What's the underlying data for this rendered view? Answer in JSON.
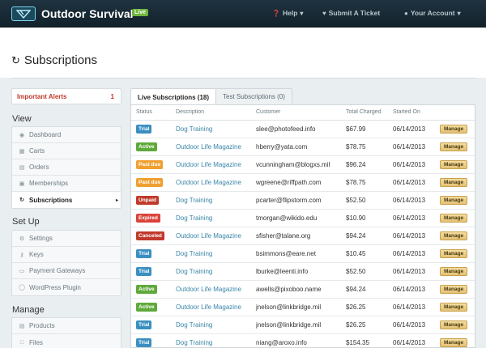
{
  "app": {
    "title": "Outdoor Survival",
    "badge": "Live"
  },
  "topnav": [
    {
      "icon": "question-icon",
      "label": "Help"
    },
    {
      "icon": "heart-icon",
      "label": "Submit A Ticket"
    },
    {
      "icon": "user-icon",
      "label": "Your Account"
    }
  ],
  "page": {
    "title": "Subscriptions"
  },
  "alerts": {
    "label": "Important Alerts",
    "count": "1"
  },
  "sections": {
    "view": "View",
    "setup": "Set Up",
    "manage": "Manage"
  },
  "view_menu": [
    {
      "icon": "dashboard-icon",
      "label": "Dashboard"
    },
    {
      "icon": "cart-icon",
      "label": "Carts"
    },
    {
      "icon": "orders-icon",
      "label": "Orders"
    },
    {
      "icon": "memberships-icon",
      "label": "Memberships"
    },
    {
      "icon": "refresh-icon",
      "label": "Subscriptions",
      "active": true
    }
  ],
  "setup_menu": [
    {
      "icon": "gear-icon",
      "label": "Settings"
    },
    {
      "icon": "key-icon",
      "label": "Keys"
    },
    {
      "icon": "card-icon",
      "label": "Payment Gateways"
    },
    {
      "icon": "wordpress-icon",
      "label": "WordPress Plugin"
    }
  ],
  "manage_menu": [
    {
      "icon": "book-icon",
      "label": "Products"
    },
    {
      "icon": "file-icon",
      "label": "Files"
    }
  ],
  "tabs": [
    {
      "label": "Live Subscriptions (18)",
      "active": true
    },
    {
      "label": "Test Subscriptions (0)",
      "active": false
    }
  ],
  "table": {
    "headers": [
      "Status",
      "Description",
      "Customer",
      "Total Charged",
      "Started On",
      ""
    ],
    "manage_label": "Manage",
    "status_colors": {
      "Trial": "#3a8fc0",
      "Active": "#5ea93a",
      "Past due": "#f0a030",
      "Unpaid": "#c0392b",
      "Expired": "#d9433a",
      "Canceled": "#c0392b"
    },
    "rows": [
      {
        "status": "Trial",
        "description": "Dog Training",
        "customer": "slee@photofeed.info",
        "total": "$67.99",
        "started": "06/14/2013"
      },
      {
        "status": "Active",
        "description": "Outdoor Life Magazine",
        "customer": "hberry@yata.com",
        "total": "$78.75",
        "started": "06/14/2013"
      },
      {
        "status": "Past due",
        "description": "Outdoor Life Magazine",
        "customer": "vcunningham@blogxs.mil",
        "total": "$96.24",
        "started": "06/14/2013"
      },
      {
        "status": "Past due",
        "description": "Outdoor Life Magazine",
        "customer": "wgreene@riffpath.com",
        "total": "$78.75",
        "started": "06/14/2013"
      },
      {
        "status": "Unpaid",
        "description": "Dog Training",
        "customer": "pcarter@flipstorm.com",
        "total": "$52.50",
        "started": "06/14/2013"
      },
      {
        "status": "Expired",
        "description": "Dog Training",
        "customer": "tmorgan@wikido.edu",
        "total": "$10.90",
        "started": "06/14/2013"
      },
      {
        "status": "Canceled",
        "description": "Outdoor Life Magazine",
        "customer": "sfisher@talane.org",
        "total": "$94.24",
        "started": "06/14/2013"
      },
      {
        "status": "Trial",
        "description": "Dog Training",
        "customer": "bsimmons@eare.net",
        "total": "$10.45",
        "started": "06/14/2013"
      },
      {
        "status": "Trial",
        "description": "Dog Training",
        "customer": "lburke@leenti.info",
        "total": "$52.50",
        "started": "06/14/2013"
      },
      {
        "status": "Active",
        "description": "Outdoor Life Magazine",
        "customer": "awells@pixoboo.name",
        "total": "$94.24",
        "started": "06/14/2013"
      },
      {
        "status": "Active",
        "description": "Outdoor Life Magazine",
        "customer": "jnelson@linkbridge.mil",
        "total": "$26.25",
        "started": "06/14/2013"
      },
      {
        "status": "Trial",
        "description": "Dog Training",
        "customer": "jnelson@linkbridge.mil",
        "total": "$26.25",
        "started": "06/14/2013"
      },
      {
        "status": "Trial",
        "description": "Dog Training",
        "customer": "niang@aroxo.info",
        "total": "$154.35",
        "started": "06/14/2013"
      }
    ]
  }
}
